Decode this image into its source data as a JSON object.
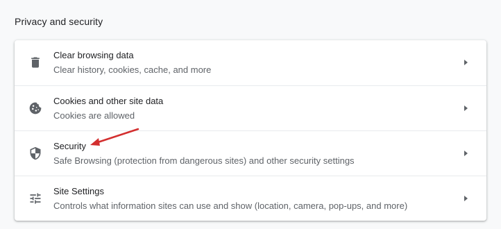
{
  "section": {
    "title": "Privacy and security"
  },
  "items": [
    {
      "icon": "trash-icon",
      "label": "Clear browsing data",
      "sublabel": "Clear history, cookies, cache, and more"
    },
    {
      "icon": "cookie-icon",
      "label": "Cookies and other site data",
      "sublabel": "Cookies are allowed"
    },
    {
      "icon": "shield-icon",
      "label": "Security",
      "sublabel": "Safe Browsing (protection from dangerous sites) and other security settings"
    },
    {
      "icon": "tune-icon",
      "label": "Site Settings",
      "sublabel": "Controls what information sites can use and show (location, camera, pop-ups, and more)"
    }
  ],
  "colors": {
    "background": "#f8f9fa",
    "card": "#ffffff",
    "text_primary": "#202124",
    "text_secondary": "#5f6368",
    "icon": "#5f6368",
    "annotation_arrow": "#d32f2f"
  }
}
